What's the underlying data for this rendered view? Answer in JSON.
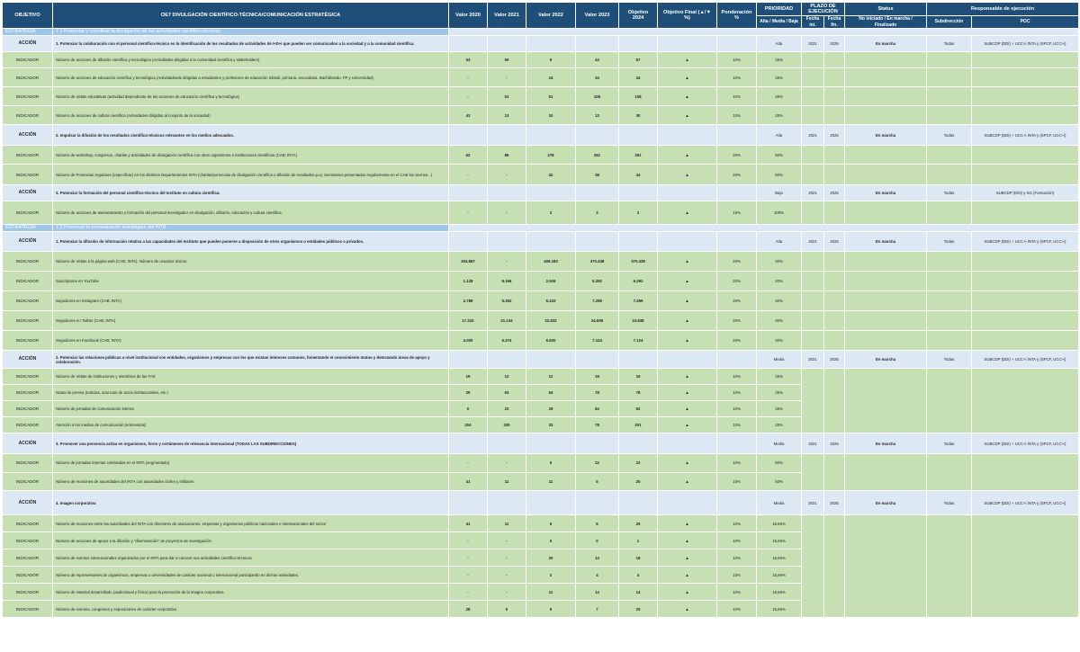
{
  "header": {
    "objetivo": "OBJETIVO",
    "title": "OE7 DIVULGACIÓN CIENTÍFICO-TÉCNICA/COMUNICACIÓN ESTRATÉGICA",
    "v2020": "Valor 2020",
    "v2021": "Valor 2021",
    "v2022": "Valor 2022",
    "v2023": "Valor 2023",
    "obj2024": "Objetivo 2024",
    "objfinal": "Objetivo Final (▲/▼ %)",
    "ponderacion": "Ponderación %",
    "prioridad": "PRIORIDAD",
    "plazo": "PLAZO DE EJECUCIÓN",
    "status": "Status",
    "responsable": "Responsable de ejecución",
    "prioridad_sub": "Alta / Media / Baja",
    "fecha_ini": "Fecha ini.",
    "fecha_fin": "Fecha fin.",
    "status_sub": "No iniciado / En marcha / Finalizado",
    "subdireccion": "Subdirección",
    "poc": "POC"
  },
  "rows": [
    {
      "t": "sec",
      "label": "ESTRATEGIA",
      "desc": "7.1 Potenciar y coordinar la divulgación de las actividades científico-técnicas"
    },
    {
      "t": "acc",
      "label": "ACCIÓN",
      "desc": "1. Potenciar la colaboración con el personal científico-técnico en la identificación de los resultados de actividades de I+D+i que pueden ser comunicados a la sociedad y a la comunidad científica.",
      "prio": "Alta",
      "ini": "2021",
      "fin": "2025",
      "status": "En marcha",
      "sub": "Todas",
      "poc": "SUBCDP (DDI) + UCC+i INTA y (SPCF, UCC+i)",
      "h": 18
    },
    {
      "t": "ind",
      "label": "INDICADOR",
      "desc": "Número de acciones de difusión científica y tecnológica (Actividades dirigidas a la comunidad científica y stakeholders)",
      "vals": [
        "53",
        "50",
        "9",
        "43",
        "57"
      ],
      "tri": "▲",
      "obj": "10%",
      "pond": "25%",
      "h": 18
    },
    {
      "t": "ind",
      "label": "INDICADOR",
      "desc": "Número de acciones de educación científica y tecnológica (Actividadesde dirigidas a estudiantes y profesores de educación infantil, primaria, secundaria, Bachillerado, FP y Universidad)",
      "vals": [
        "-",
        "-",
        "24",
        "34",
        "34"
      ],
      "tri": "▲",
      "obj": "10%",
      "pond": "25%",
      "h": 21
    },
    {
      "t": "ind",
      "label": "INDICADOR",
      "desc": "Número de visitas educativas (actividad dependiente de las acciones de educación científica y tecnológica)",
      "vals": [
        "-",
        "51",
        "51",
        "108",
        "108"
      ],
      "tri": "▲",
      "obj": "10%",
      "pond": "25%",
      "h": 21
    },
    {
      "t": "ind",
      "label": "INDICADOR",
      "desc": "Número de acciones de cultura científica (Actividades dirigidas al conjunto de la sociedad)",
      "vals": [
        "43",
        "13",
        "10",
        "12",
        "30"
      ],
      "tri": "▲",
      "obj": "10%",
      "pond": "25%",
      "h": 21
    },
    {
      "t": "acc",
      "label": "ACCIÓN",
      "desc": "2. Impulsar la difusión de los resultados científico-técnicos relevantes en los medios adecuados.",
      "prio": "Alta",
      "ini": "2021",
      "fin": "2025",
      "status": "En marcha",
      "sub": "Todas",
      "poc": "SUBCDP (DDI) + UCC+i INTA y (SPCF, UCC+i)",
      "h": 23
    },
    {
      "t": "ind",
      "label": "INDICADOR",
      "desc": "Número de workshop, congresos, charlas y actividades de divulgación científica con otros organismos e instituciones científicas (CAB; INTA)",
      "vals": [
        "62",
        "86",
        "278",
        "261",
        "261"
      ],
      "tri": "▲",
      "obj": "20%",
      "pond": "50%",
      "poc": "SUBCDP (DDI)",
      "h": 21
    },
    {
      "t": "ind",
      "label": "INDICADOR",
      "desc": "Número de Ponencias regulares (especificar) en los distintos Departamentos INTA (charlas/ponencias de divulgación científica o difusión de resultados p.ej: Seminarios presentados regularmente en el CAB los viernes...)",
      "vals": [
        "-",
        "-",
        "42",
        "38",
        "44"
      ],
      "tri": "▲",
      "obj": "20%",
      "pond": "50%",
      "poc": "SUBCDP (DDI)",
      "h": 23
    },
    {
      "t": "acc",
      "label": "ACCIÓN",
      "desc": "3. Potenciar la formación del personal científico-técnico del Instituto en cultura científica.",
      "prio": "Baja",
      "ini": "2021",
      "fin": "2025",
      "status": "En marcha",
      "sub": "Todas",
      "poc": "SUBCDP (DDI) y SG (Formación)",
      "h": 18
    },
    {
      "t": "ind",
      "label": "INDICADOR",
      "desc": "Número de acciones de asesoramiento y formación del personal investigador en divulgación, difusión, educación y cultura científica.",
      "vals": [
        "-",
        "-",
        "3",
        "3",
        "3"
      ],
      "tri": "▲",
      "obj": "15%",
      "pond": "100%",
      "poc": "SUBCDP (DDI) y SG (Formación)",
      "h": 9
    },
    {
      "t": "sec",
      "label": "ESTRATEGIA",
      "desc": "7.2 Promover la comunicación estratégica del INTA"
    },
    {
      "t": "acc",
      "label": "ACCIÓN",
      "desc": "1. Potenciar la difusión de información relativa a las capacidades del Instituto que pueden ponerse a disposición de otros organismos o entidades públicos o privados.",
      "prio": "Alta",
      "ini": "2021",
      "fin": "2025",
      "status": "En marcha",
      "sub": "Todas",
      "poc": "SUBCDP (DDI) + UCC+i INTA y (SPCF, UCC+i)",
      "h": 22
    },
    {
      "t": "ind",
      "label": "INDICADOR",
      "desc": "Número de visitas a la página web (CAB; INTA). Número de usuarios únicos.",
      "vals": [
        "304.887",
        "-",
        "409.183",
        "370.438",
        "370.438"
      ],
      "tri": "▲",
      "obj": "20%",
      "pond": "20%",
      "h": 22
    },
    {
      "t": "ind",
      "label": "INDICADOR",
      "desc": "Suscriptores en YouTube",
      "vals": [
        "1.128",
        "6.166",
        "2.526",
        "6.292",
        "6.292"
      ],
      "tri": "▲",
      "obj": "20%",
      "pond": "20%",
      "h": 22
    },
    {
      "t": "ind",
      "label": "INDICADOR",
      "desc": "Seguidores en Instagram (CAB; INTA)",
      "vals": [
        "2.789",
        "5.352",
        "6.102",
        "7.259",
        "7.259"
      ],
      "tri": "▲",
      "obj": "20%",
      "pond": "20%",
      "h": 22
    },
    {
      "t": "ind",
      "label": "INDICADOR",
      "desc": "Seguidores en Twitter (CAB; INTA)",
      "vals": [
        "17.210",
        "21.134",
        "22.832",
        "24.938",
        "24.938"
      ],
      "tri": "▲",
      "obj": "20%",
      "pond": "20%",
      "h": 22
    },
    {
      "t": "ind",
      "label": "INDICADOR",
      "desc": "Seguidores en Facebook (CAB; INTA)",
      "vals": [
        "4.000",
        "6.374",
        "6.620",
        "7.124",
        "7.124"
      ],
      "tri": "▲",
      "obj": "20%",
      "pond": "20%",
      "h": 22
    },
    {
      "t": "acc",
      "label": "ACCIÓN",
      "desc": "2. Potenciar las relaciones públicas a nivel institucional con entidades, organismos y empresas con los que existan intereses comunes, fomentando el conocimiento mutuo y detectando áreas de apoyo y colaboración.",
      "prio": "Media",
      "ini": "2021",
      "fin": "2025",
      "status": "En marcha",
      "sub": "Todas",
      "poc": "SUBCDP (DDI) + UCC+i INTA y (SPCF, UCC+i)",
      "h": 20
    },
    {
      "t": "ind",
      "label": "INDICADOR",
      "desc": "Número de visitas de instituciones y miembros de las FAS",
      "vals": [
        "19",
        "12",
        "12",
        "15",
        "15"
      ],
      "tri": "▲",
      "obj": "10%",
      "pond": "25%",
      "h": 18
    },
    {
      "t": "ind",
      "label": "INDICADOR",
      "desc": "Notas de prensa (noticias, anuncios de actos institucionales, etc.)",
      "vals": [
        "29",
        "63",
        "64",
        "78",
        "78"
      ],
      "tri": "▲",
      "obj": "10%",
      "pond": "25%",
      "h": 18
    },
    {
      "t": "ind",
      "label": "INDICADOR",
      "desc": "Número de jornadas de comunicación interna",
      "vals": [
        "0",
        "22",
        "29",
        "62",
        "62"
      ],
      "tri": "▲",
      "obj": "10%",
      "pond": "25%",
      "h": 18
    },
    {
      "t": "ind",
      "label": "INDICADOR",
      "desc": "Atención a los medios de comunicación (entrevistas)",
      "vals": [
        "204",
        "330",
        "33",
        "78",
        "201"
      ],
      "tri": "▲",
      "obj": "10%",
      "pond": "25%",
      "h": 18
    },
    {
      "t": "acc",
      "label": "ACCIÓN",
      "desc": "3. Promover una presencia activa en organismos, foros y certámenes de relevancia internacional (TODAS LAS SUBDIRECCIONES)",
      "prio": "Media",
      "ini": "2021",
      "fin": "2025",
      "status": "En marcha",
      "sub": "Todas",
      "poc": "SUBCDP (DDI) + UCC+i INTA y (SPCF, UCC+i)",
      "h": 23
    },
    {
      "t": "ind",
      "label": "INDICADOR",
      "desc": "Número de jornadas internas celebradas en el INTA (segmentado)",
      "vals": [
        "-",
        "-",
        "5",
        "22",
        "22"
      ],
      "tri": "▲",
      "obj": "10%",
      "pond": "50%",
      "h": 19
    },
    {
      "t": "ind",
      "label": "INDICADOR",
      "desc": "Número de reuniones de autoridades del INTA con autoridades civiles y militares",
      "vals": [
        "41",
        "11",
        "11",
        "5",
        "25"
      ],
      "tri": "▲",
      "obj": "10%",
      "pond": "50%",
      "h": 19
    },
    {
      "t": "acc",
      "label": "ACCIÓN",
      "desc": "4. Imagen corporativa",
      "prio": "Media",
      "ini": "2021",
      "fin": "2025",
      "status": "En marcha",
      "sub": "Todas",
      "poc": "SUBCDP (DDI) + UCC+i INTA y (SPCF, UCC+i)",
      "h": 27
    },
    {
      "t": "ind",
      "label": "INDICADOR",
      "desc": "Número de reuniones entre las autoridades del INTA con directores de asociaciones, empresas y organismos públicos nacionales e internacionales del sector",
      "vals": [
        "41",
        "11",
        "6",
        "6",
        "26"
      ],
      "tri": "▲",
      "obj": "10%",
      "pond": "16,66%",
      "h": 19
    },
    {
      "t": "ind",
      "label": "INDICADOR",
      "desc": "Número de acciones de apoyo a la difusión y \"diseminación\" de proyectos de investigación",
      "vals": [
        "-",
        "-",
        "0",
        "0",
        "1"
      ],
      "tri": "▲",
      "obj": "10%",
      "pond": "16,66%",
      "h": 19
    },
    {
      "t": "ind",
      "label": "INDICADOR",
      "desc": "Número de eventos internacionales organizados por el INTA para dar a conocer sus actividades científico-técnicas",
      "vals": [
        "-",
        "-",
        "20",
        "14",
        "18"
      ],
      "tri": "▲",
      "obj": "10%",
      "pond": "16,66%",
      "h": 19
    },
    {
      "t": "ind",
      "label": "INDICADOR",
      "desc": "Número de representantes de organismos, empresas o universidades de carácter nacional o internacional participando en dichas actividades.",
      "vals": [
        "-",
        "-",
        "2",
        "4",
        "4"
      ],
      "tri": "▲",
      "obj": "10%",
      "pond": "16,66%",
      "h": 19
    },
    {
      "t": "ind",
      "label": "INDICADOR",
      "desc": "Número de material desarrollado (audiovisual y físico) para la promoción de la imagen corporativa",
      "vals": [
        "-",
        "-",
        "11",
        "14",
        "14"
      ],
      "tri": "▲",
      "obj": "10%",
      "pond": "16,66%",
      "h": 19
    },
    {
      "t": "ind",
      "label": "INDICADOR",
      "desc": "Número de eventos, congresos y exposiciones de carácter corporativo",
      "vals": [
        "28",
        "9",
        "9",
        "7",
        "19"
      ],
      "tri": "▲",
      "obj": "10%",
      "pond": "16,66%",
      "h": 19
    }
  ],
  "poc_groups": [
    {
      "text": "SUBCDP (DDI)"
    },
    {
      "text": "SUBCDP (DDI) + UCC+i INTA y (SPCF, UCC+i)"
    },
    {
      "text": "SUBCDP (DDI) + UCC+i INTA y (SPCF, UCC+i)"
    },
    {
      "text": "SUBCDP (DDI) + UCC+i INTA y (SPCF, UCC+i)"
    },
    {
      "text": "SUBCDP (DDI) + UCC+i INTA y (SPCF, UCC+i)"
    }
  ]
}
